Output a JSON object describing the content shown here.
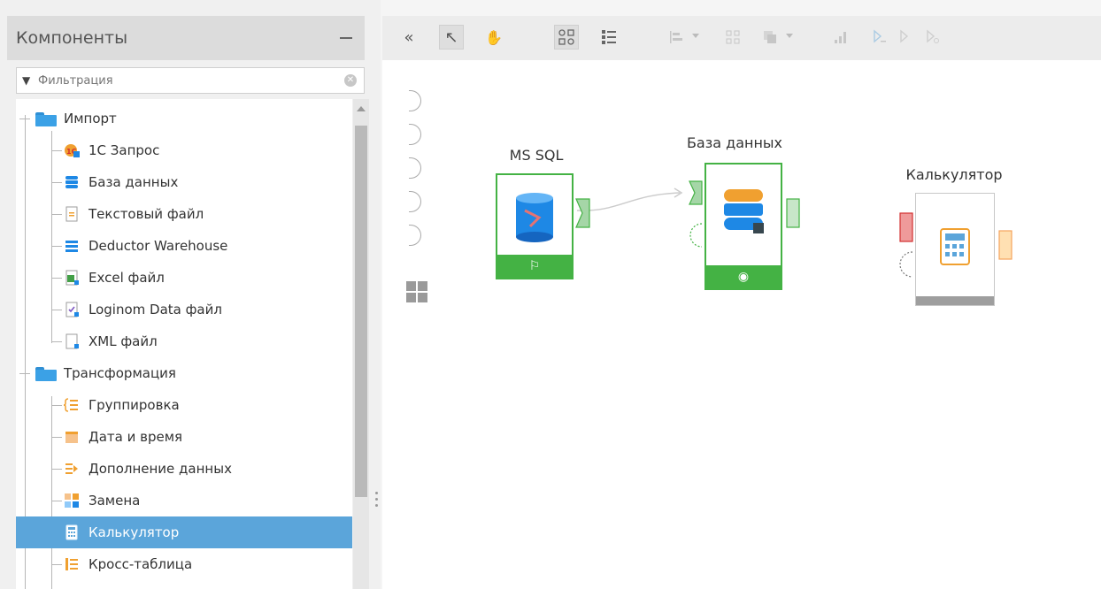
{
  "panel": {
    "title": "Компоненты",
    "filter_placeholder": "Фильтрация"
  },
  "tree": {
    "folders": [
      {
        "label": "Импорт"
      },
      {
        "label": "Трансформация"
      }
    ],
    "import_items": [
      {
        "label": "1С Запрос",
        "icon": "1c-query-icon"
      },
      {
        "label": "База данных",
        "icon": "database-icon"
      },
      {
        "label": "Текстовый файл",
        "icon": "text-file-icon"
      },
      {
        "label": "Deductor Warehouse",
        "icon": "warehouse-icon"
      },
      {
        "label": "Excel файл",
        "icon": "excel-file-icon"
      },
      {
        "label": "Loginom Data файл",
        "icon": "loginom-data-file-icon"
      },
      {
        "label": "XML файл",
        "icon": "xml-file-icon"
      }
    ],
    "transform_items": [
      {
        "label": "Группировка",
        "icon": "grouping-icon"
      },
      {
        "label": "Дата и время",
        "icon": "calendar-icon"
      },
      {
        "label": "Дополнение данных",
        "icon": "data-append-icon"
      },
      {
        "label": "Замена",
        "icon": "replace-icon"
      },
      {
        "label": "Калькулятор",
        "icon": "calculator-icon",
        "selected": true
      },
      {
        "label": "Кросс-таблица",
        "icon": "cross-table-icon"
      }
    ]
  },
  "toolbar": {
    "collapse": "«",
    "pointer": "↖",
    "hand": "✋"
  },
  "canvas": {
    "nodes": [
      {
        "label": "MS SQL",
        "status": "active",
        "footer_icon": "flag-icon"
      },
      {
        "label": "База данных",
        "status": "active",
        "footer_icon": "eye-icon"
      },
      {
        "label": "Калькулятор",
        "status": "inactive"
      }
    ]
  },
  "colors": {
    "accent_green": "#44b244",
    "selection_blue": "#5ba5da",
    "port_red": "#e57373",
    "port_orange": "#f5a35c"
  }
}
